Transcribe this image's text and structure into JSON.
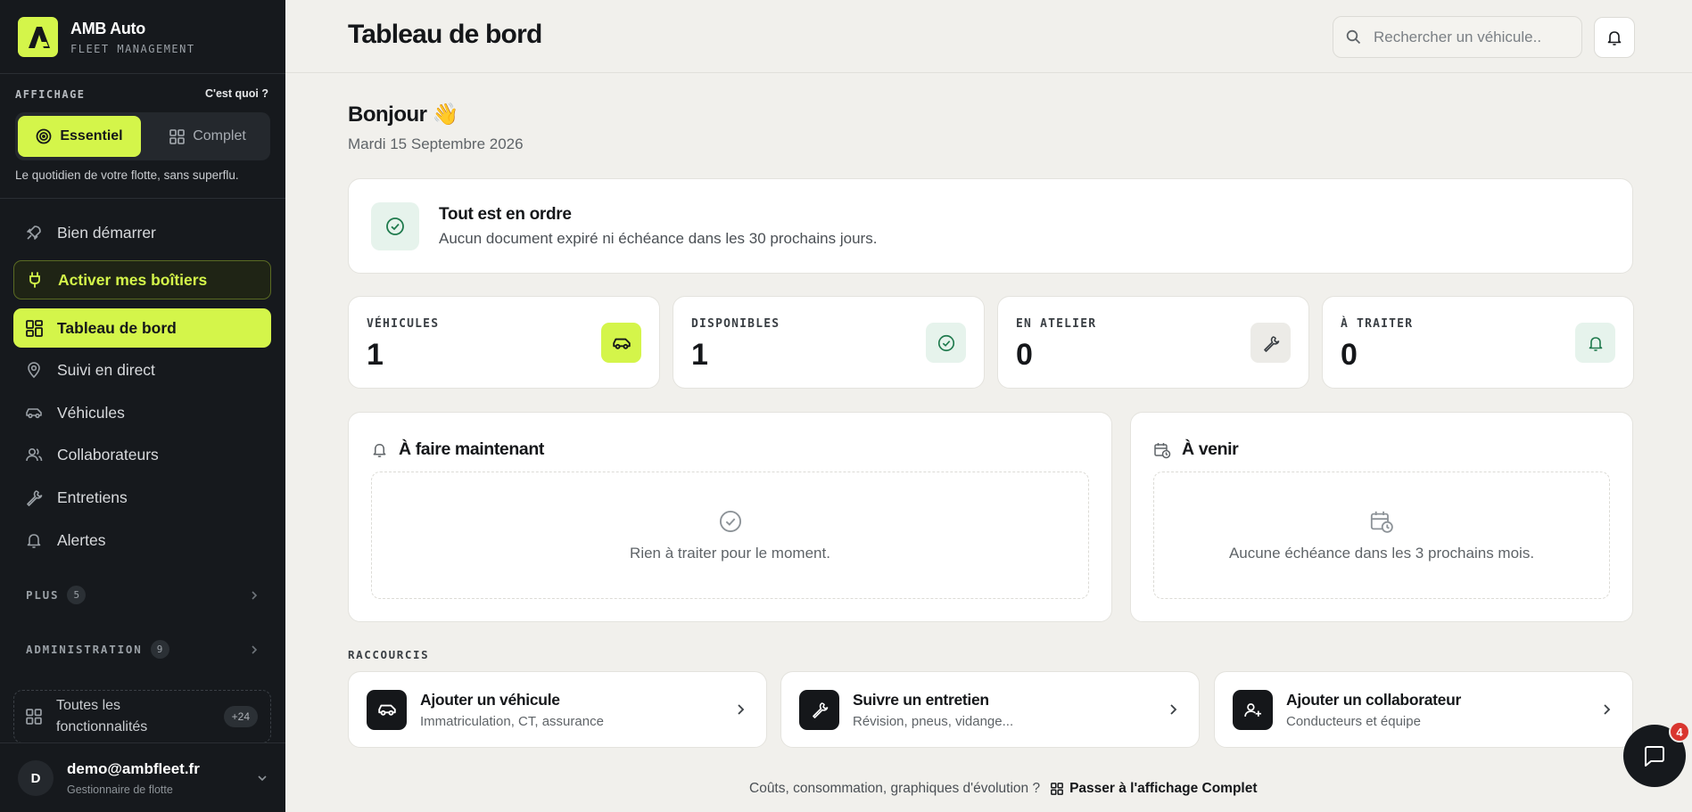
{
  "brand": {
    "name": "AMB Auto",
    "subtitle": "FLEET MANAGEMENT"
  },
  "affichage": {
    "label": "AFFICHAGE",
    "help": "C'est quoi ?",
    "modes": [
      "Essentiel",
      "Complet"
    ],
    "selected": "Essentiel",
    "description": "Le quotidien de votre flotte, sans superflu."
  },
  "nav": {
    "start": "Bien démarrer",
    "activate": "Activer mes boîtiers",
    "dashboard": "Tableau de bord",
    "tracking": "Suivi en direct",
    "vehicles": "Véhicules",
    "staff": "Collaborateurs",
    "maintenance": "Entretiens",
    "alerts": "Alertes",
    "plus_label": "PLUS",
    "plus_count": "5",
    "admin_label": "ADMINISTRATION",
    "admin_count": "9",
    "all_features": "Toutes les fonctionnalités",
    "all_features_badge": "+24"
  },
  "user": {
    "initial": "D",
    "email": "demo@ambfleet.fr",
    "role": "Gestionnaire de flotte"
  },
  "header": {
    "title": "Tableau de bord",
    "search_placeholder": "Rechercher un véhicule.."
  },
  "greeting": {
    "title": "Bonjour 👋",
    "date": "Mardi 15 Septembre 2026"
  },
  "status": {
    "title": "Tout est en ordre",
    "text": "Aucun document expiré ni échéance dans les 30 prochains jours."
  },
  "stats": [
    {
      "label": "VÉHICULES",
      "value": "1",
      "icon": "car-icon",
      "bg": "#d4f54a"
    },
    {
      "label": "DISPONIBLES",
      "value": "1",
      "icon": "check-circle-icon",
      "bg": "#e6f3ec"
    },
    {
      "label": "EN ATELIER",
      "value": "0",
      "icon": "wrench-icon",
      "bg": "#ecebe7"
    },
    {
      "label": "À TRAITER",
      "value": "0",
      "icon": "bell-icon",
      "bg": "#e6f3ec"
    }
  ],
  "todo": {
    "title": "À faire maintenant",
    "empty": "Rien à traiter pour le moment."
  },
  "upcoming": {
    "title": "À venir",
    "empty": "Aucune échéance dans les 3 prochains mois."
  },
  "shortcuts": {
    "label": "RACCOURCIS",
    "items": [
      {
        "title": "Ajouter un véhicule",
        "subtitle": "Immatriculation, CT, assurance",
        "icon": "car-icon"
      },
      {
        "title": "Suivre un entretien",
        "subtitle": "Révision, pneus, vidange...",
        "icon": "wrench-icon"
      },
      {
        "title": "Ajouter un collaborateur",
        "subtitle": "Conducteurs et équipe",
        "icon": "user-plus-icon"
      }
    ]
  },
  "footer": {
    "question": "Coûts, consommation, graphiques d'évolution ?",
    "link": "Passer à l'affichage Complet"
  },
  "chat": {
    "badge": "4"
  },
  "colors": {
    "accent": "#d4f54a",
    "sidebar": "#16191d",
    "background": "#f1f0ec",
    "success": "#1f7a4d"
  }
}
